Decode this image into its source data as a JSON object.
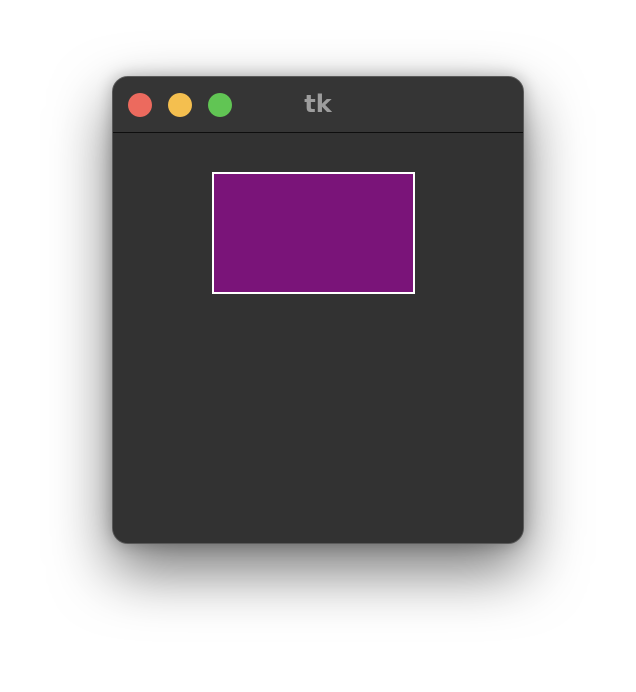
{
  "window": {
    "title": "tk"
  },
  "controls": {
    "close": {
      "color": "#ec6a5e"
    },
    "minimize": {
      "color": "#f4bf4f"
    },
    "maximize": {
      "color": "#61c554"
    }
  },
  "canvas": {
    "background": "#323232",
    "rectangle": {
      "fill": "#7a1479",
      "outline": "#ffffff"
    }
  }
}
